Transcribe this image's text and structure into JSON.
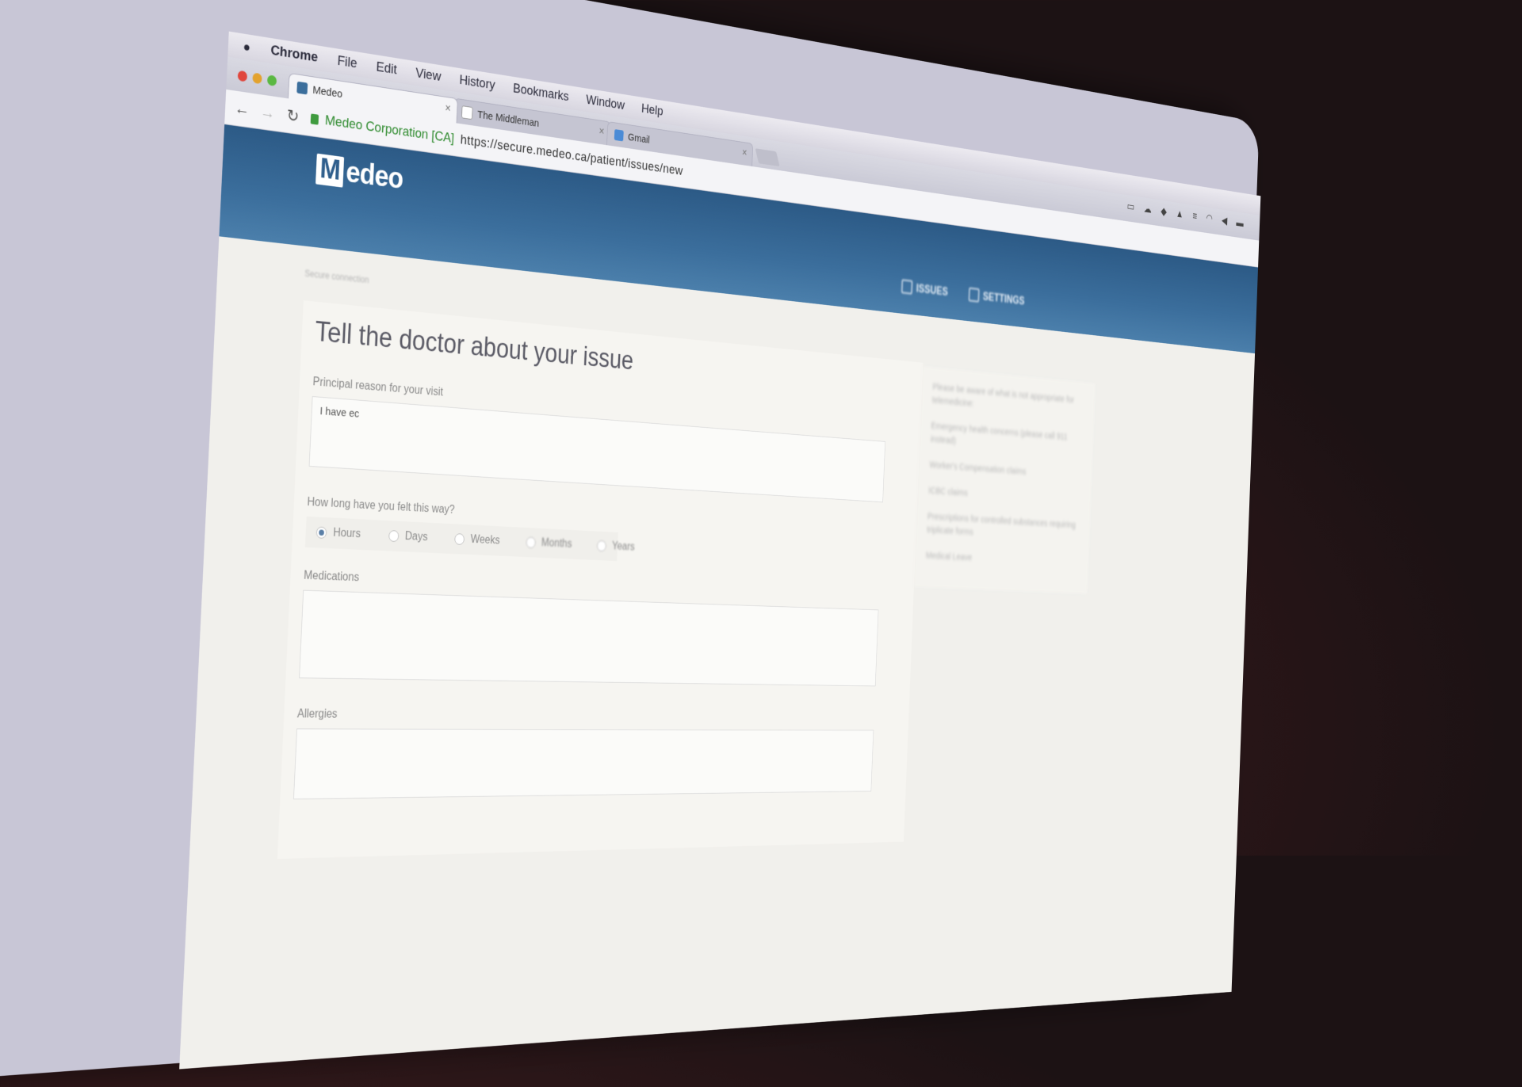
{
  "menubar": {
    "app": "Chrome",
    "items": [
      "File",
      "Edit",
      "View",
      "History",
      "Bookmarks",
      "Window",
      "Help"
    ]
  },
  "tabs": [
    {
      "title": "Medeo",
      "active": true
    },
    {
      "title": "The Middleman",
      "active": false
    },
    {
      "title": "Gmail",
      "active": false
    }
  ],
  "address": {
    "ev_label": "Medeo Corporation [CA]",
    "url": "https://secure.medeo.ca/patient/issues/new"
  },
  "site": {
    "logo_text": "edeo",
    "logo_letter": "M",
    "nav": [
      "ISSUES",
      "SETTINGS"
    ]
  },
  "page": {
    "secure_note": "Secure connection",
    "title": "Tell the doctor about your issue",
    "reason_label": "Principal reason for your visit",
    "reason_value": "I have ec",
    "duration_label": "How long have you felt this way?",
    "duration_options": [
      "Hours",
      "Days",
      "Weeks",
      "Months",
      "Years"
    ],
    "duration_selected": "Hours",
    "medications_label": "Medications",
    "allergies_label": "Allergies"
  },
  "sidebar": {
    "lines": [
      "Please be aware of what is not appropriate for telemedicine:",
      "Emergency health concerns (please call 911 instead)",
      "Worker's Compensation claims",
      "ICBC claims",
      "Prescriptions for controlled substances requiring triplicate forms",
      "Medical Leave"
    ]
  },
  "colors": {
    "header": "#3b6e9c",
    "ev_green": "#2d8a2d",
    "radio_selected": "#5a7fa6"
  }
}
